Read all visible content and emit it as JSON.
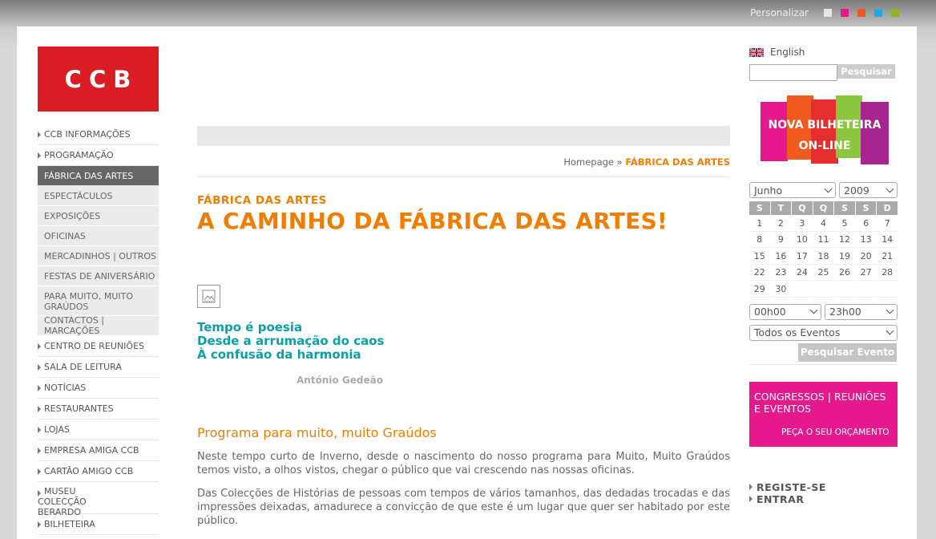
{
  "topbar": {
    "label": "Personalizar",
    "swatches": [
      "#e6e6e6",
      "#e5198d",
      "#f05a1e",
      "#2ba6de",
      "#8cb526"
    ]
  },
  "logo": {
    "text": "CCB"
  },
  "nav": [
    {
      "label": "CCB INFORMAÇÕES",
      "type": "main"
    },
    {
      "label": "PROGRAMAÇÃO",
      "type": "main"
    },
    {
      "label": "FÁBRICA DAS ARTES",
      "type": "active"
    },
    {
      "label": "ESPECTÁCULOS",
      "type": "sub"
    },
    {
      "label": "EXPOSIÇÕES",
      "type": "sub"
    },
    {
      "label": "OFICINAS",
      "type": "sub"
    },
    {
      "label": "MERCADINHOS | OUTROS",
      "type": "sub"
    },
    {
      "label": "FESTAS DE ANIVERSÁRIO",
      "type": "sub"
    },
    {
      "label": "PARA MUITO, MUITO GRAÚDOS",
      "type": "sub2"
    },
    {
      "label": "CONTACTOS | MARCAÇÕES",
      "type": "sub"
    },
    {
      "label": "CENTRO DE REUNIÕES",
      "type": "main"
    },
    {
      "label": "SALA DE LEITURA",
      "type": "main"
    },
    {
      "label": "NOTÍCIAS",
      "type": "main"
    },
    {
      "label": "RESTAURANTES",
      "type": "main"
    },
    {
      "label": "LOJAS",
      "type": "main"
    },
    {
      "label": "EMPRESA AMIGA CCB",
      "type": "main"
    },
    {
      "label": "CARTÃO AMIGO CCB",
      "type": "main"
    },
    {
      "label": "MUSEU COLECÇÃO BERARDO",
      "type": "main2"
    },
    {
      "label": "BILHETEIRA",
      "type": "main"
    }
  ],
  "breadcrumb": {
    "home": "Homepage",
    "sep": "»",
    "current": "FÁBRICA DAS ARTES"
  },
  "article": {
    "section": "FÁBRICA DAS ARTES",
    "title": "A CAMINHO DA FÁBRICA DAS ARTES!",
    "poem": [
      "Tempo é poesia",
      "Desde a arrumação do caos",
      "À confusão da harmonia"
    ],
    "author": "António Gedeão",
    "program_title": "Programa para muito, muito Graúdos",
    "paragraphs": [
      "Neste tempo curto de Inverno, desde o nascimento do nosso programa para Muito, Muito Graúdos temos visto, a olhos vistos, chegar o público que vai crescendo nas nossas oficinas.",
      "Das Colecções de Histórias de pessoas com tempos de vários tamanhos, das dedadas trocadas e das impressões deixadas, amadurece a convicção de que este é um lugar que quer ser habitado por este público."
    ]
  },
  "sidebar": {
    "language": "English",
    "search_button": "Pesquisar",
    "search_value": "",
    "banner1": {
      "line1": "NOVA BILHETEIRA",
      "line2": "ON-LINE",
      "colors": [
        "#e5198d",
        "#f05a1e",
        "#e62e2e",
        "#8cc63f",
        "#a8258f"
      ]
    },
    "month": "Junho",
    "year": "2009",
    "weekdays": [
      "S",
      "T",
      "Q",
      "Q",
      "S",
      "S",
      "D"
    ],
    "weeks": [
      [
        "1",
        "2",
        "3",
        "4",
        "5",
        "6",
        "7"
      ],
      [
        "8",
        "9",
        "10",
        "11",
        "12",
        "13",
        "14"
      ],
      [
        "15",
        "16",
        "17",
        "18",
        "19",
        "20",
        "21"
      ],
      [
        "22",
        "23",
        "24",
        "25",
        "26",
        "27",
        "28"
      ],
      [
        "29",
        "30",
        "",
        "",
        "",
        "",
        ""
      ]
    ],
    "time_from": "00h00",
    "time_to": "23h00",
    "events_filter": "Todos os Eventos",
    "event_search_button": "Pesquisar Evento",
    "banner2": {
      "line1": "CONGRESSOS | REUNIÕES",
      "line2": "E EVENTOS",
      "cta": "PEÇA O SEU ORÇAMENTO"
    },
    "links": [
      "REGISTE-SE",
      "ENTRAR"
    ]
  }
}
